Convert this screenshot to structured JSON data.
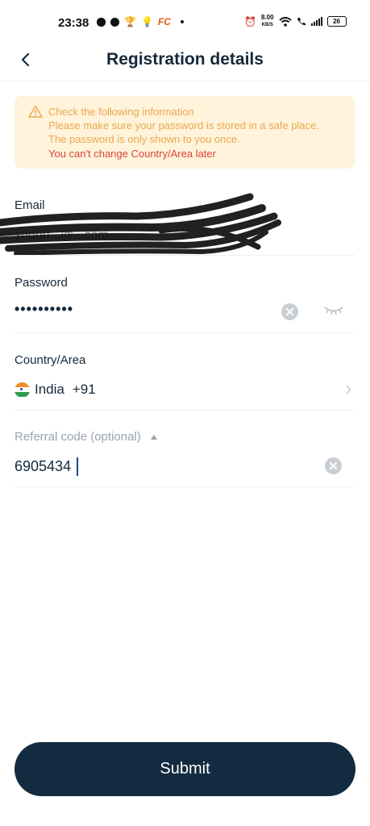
{
  "status_bar": {
    "time": "23:38",
    "notification_icons": [
      "chat-bubble-icon",
      "whatsapp-icon",
      "trophy-icon",
      "bulb-icon",
      "fc-app-icon",
      "dot-icon"
    ],
    "fc_label": "FC",
    "net_speed_value": "8.00",
    "net_speed_unit": "KB/S",
    "battery": "26"
  },
  "header": {
    "title": "Registration details",
    "back_icon": "chevron-left-icon"
  },
  "notice": {
    "icon": "warning-triangle-icon",
    "line1": "Check the following information",
    "line2": "Please make sure your password is stored in a safe place.",
    "line3": "The password is only shown to you once.",
    "warning": "You can't change Country/Area later",
    "bg_color": "#fff3db",
    "text_color": "#e8a94d",
    "warning_color": "#d9443a"
  },
  "form": {
    "email": {
      "label": "Email",
      "value": "shubh...@...com"
    },
    "password": {
      "label": "Password",
      "value": "••••••••••"
    },
    "country": {
      "label": "Country/Area",
      "name": "India",
      "code": "+91"
    },
    "referral": {
      "label": "Referral code (optional)",
      "value": "6905434"
    }
  },
  "submit": {
    "label": "Submit",
    "bg_color": "#132b40"
  }
}
